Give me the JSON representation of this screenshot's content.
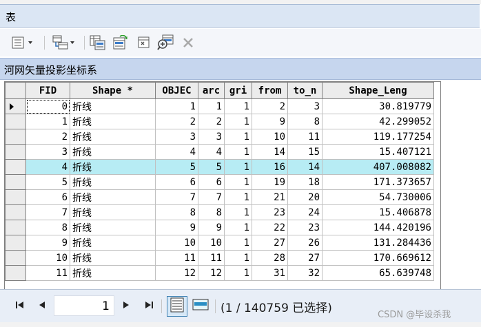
{
  "window": {
    "title": "表"
  },
  "toolbar": {
    "buttons": [
      {
        "name": "table-options-menu-button",
        "icon": "table-options-icon"
      },
      {
        "name": "related-tables-menu-button",
        "icon": "related-tables-icon"
      },
      {
        "name": "select-by-attributes-button",
        "icon": "select-by-attributes-icon"
      },
      {
        "name": "switch-selection-button",
        "icon": "switch-selection-icon"
      },
      {
        "name": "clear-selection-button",
        "icon": "clear-selection-icon"
      },
      {
        "name": "zoom-to-selected-button",
        "icon": "zoom-to-selected-icon"
      },
      {
        "name": "delete-selected-button",
        "icon": "delete-icon"
      }
    ]
  },
  "layer": {
    "name": "河网矢量投影坐标系"
  },
  "table": {
    "columns": [
      "FID",
      "Shape *",
      "OBJEC",
      "arc",
      "gri",
      "from",
      "to_n",
      "Shape_Leng"
    ],
    "rows": [
      [
        "0",
        "折线",
        "1",
        "1",
        "1",
        "2",
        "3",
        "30.819779"
      ],
      [
        "1",
        "折线",
        "2",
        "2",
        "1",
        "9",
        "8",
        "42.299052"
      ],
      [
        "2",
        "折线",
        "3",
        "3",
        "1",
        "10",
        "11",
        "119.177254"
      ],
      [
        "3",
        "折线",
        "4",
        "4",
        "1",
        "14",
        "15",
        "15.407121"
      ],
      [
        "4",
        "折线",
        "5",
        "5",
        "1",
        "16",
        "14",
        "407.008082"
      ],
      [
        "5",
        "折线",
        "6",
        "6",
        "1",
        "19",
        "18",
        "171.373657"
      ],
      [
        "6",
        "折线",
        "7",
        "7",
        "1",
        "21",
        "20",
        "54.730006"
      ],
      [
        "7",
        "折线",
        "8",
        "8",
        "1",
        "23",
        "24",
        "15.406878"
      ],
      [
        "8",
        "折线",
        "9",
        "9",
        "1",
        "22",
        "23",
        "144.420196"
      ],
      [
        "9",
        "折线",
        "10",
        "10",
        "1",
        "27",
        "26",
        "131.284436"
      ],
      [
        "10",
        "折线",
        "11",
        "11",
        "1",
        "28",
        "27",
        "170.669612"
      ],
      [
        "11",
        "折线",
        "12",
        "12",
        "1",
        "31",
        "32",
        "65.639748"
      ]
    ],
    "selected_row": 4,
    "current_row": 0
  },
  "status": {
    "current_record": "1",
    "count_text": "(1 / 140759 已选择)"
  },
  "watermark": "CSDN @毕设杀我",
  "colors": {
    "selected_row": "#b7ecf4",
    "title_bar": "#dbe6f4",
    "layer_bar": "#c6d6ee"
  }
}
